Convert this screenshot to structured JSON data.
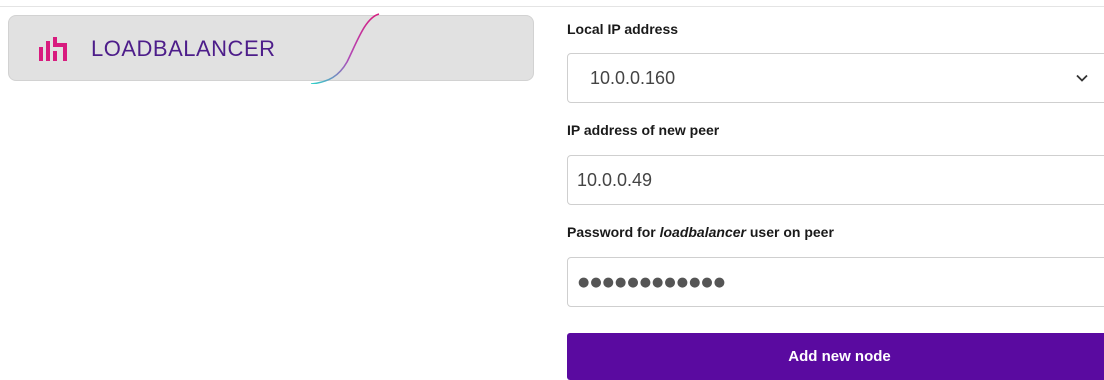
{
  "logo": {
    "text": "LOADBALANCER",
    "colors": {
      "mark": "#d81b7e",
      "text": "#4d1d8a",
      "swoosh_start": "#d81b7e",
      "swoosh_end": "#2ed3c9"
    }
  },
  "form": {
    "local_ip": {
      "label": "Local IP address",
      "value": "10.0.0.160"
    },
    "peer_ip": {
      "label": "IP address of new peer",
      "value": "10.0.0.49"
    },
    "password": {
      "label_prefix": "Password for ",
      "label_emphasis": "loadbalancer",
      "label_suffix": " user on peer",
      "masked_value": "●●●●●●●●●●●●"
    },
    "submit_label": "Add new node"
  },
  "colors": {
    "primary_button": "#5a0aa0"
  }
}
